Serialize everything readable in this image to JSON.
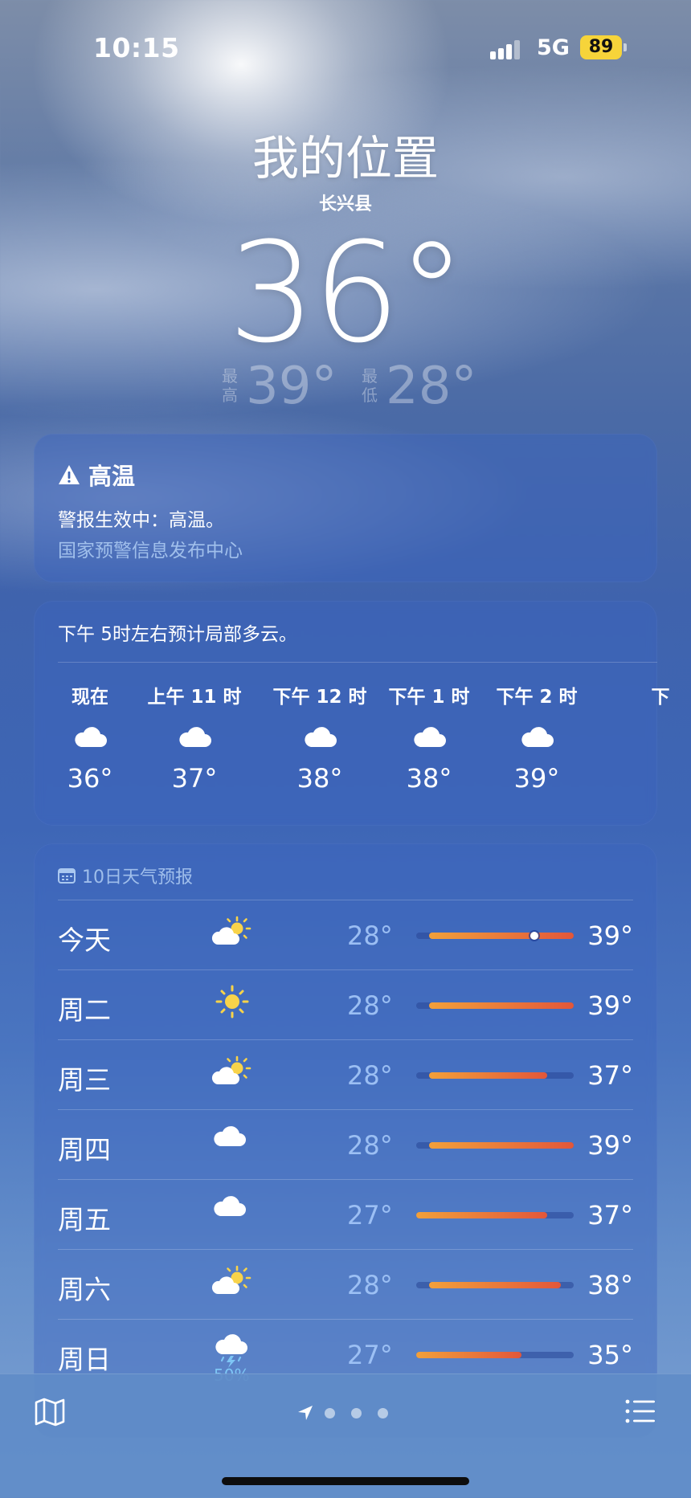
{
  "status": {
    "time": "10:15",
    "network": "5G",
    "battery": "89"
  },
  "hero": {
    "location": "我的位置",
    "sublocation": "长兴县",
    "temperature": "36°",
    "high_label": "最高",
    "high": "39°",
    "low_label": "最低",
    "low": "28°"
  },
  "alert": {
    "icon": "warning-icon",
    "title": "高温",
    "body": "警报生效中：高温。",
    "source": "国家预警信息发布中心"
  },
  "hourly": {
    "summary": "下午 5时左右预计局部多云。",
    "items": [
      {
        "label": "现在",
        "icon": "cloud-icon",
        "temp": "36°"
      },
      {
        "label": "上午 11 时",
        "icon": "cloud-icon",
        "temp": "37°"
      },
      {
        "label": "下午 12 时",
        "icon": "cloud-icon",
        "temp": "38°"
      },
      {
        "label": "下午 1 时",
        "icon": "cloud-icon",
        "temp": "38°"
      },
      {
        "label": "下午 2 时",
        "icon": "cloud-icon",
        "temp": "39°"
      },
      {
        "label": "下",
        "icon": "cloud-icon",
        "temp": ""
      }
    ]
  },
  "daily": {
    "header": "10日天气预报",
    "range": {
      "min": 27,
      "max": 39
    },
    "days": [
      {
        "name": "今天",
        "icon": "partly-sunny-icon",
        "low": "28°",
        "high": "39°",
        "low_val": 28,
        "high_val": 39,
        "current": 36
      },
      {
        "name": "周二",
        "icon": "sun-icon",
        "low": "28°",
        "high": "39°",
        "low_val": 28,
        "high_val": 39
      },
      {
        "name": "周三",
        "icon": "partly-sunny-icon",
        "low": "28°",
        "high": "37°",
        "low_val": 28,
        "high_val": 37
      },
      {
        "name": "周四",
        "icon": "cloud-icon",
        "low": "28°",
        "high": "39°",
        "low_val": 28,
        "high_val": 39
      },
      {
        "name": "周五",
        "icon": "cloud-icon",
        "low": "27°",
        "high": "37°",
        "low_val": 27,
        "high_val": 37
      },
      {
        "name": "周六",
        "icon": "partly-sunny-icon",
        "low": "28°",
        "high": "38°",
        "low_val": 28,
        "high_val": 38
      },
      {
        "name": "周日",
        "icon": "thunderstorm-icon",
        "low": "27°",
        "high": "35°",
        "low_val": 27,
        "high_val": 35,
        "precip": "50%"
      }
    ]
  },
  "bottom": {
    "map_icon": "map-icon",
    "location_icon": "location-arrow-icon",
    "list_icon": "list-icon",
    "page_dots": 3
  },
  "colors": {
    "bar_start": "#f2a03a",
    "bar_end": "#e2573a",
    "alert_source": "#aac8f0",
    "battery": "#f6d43a"
  }
}
